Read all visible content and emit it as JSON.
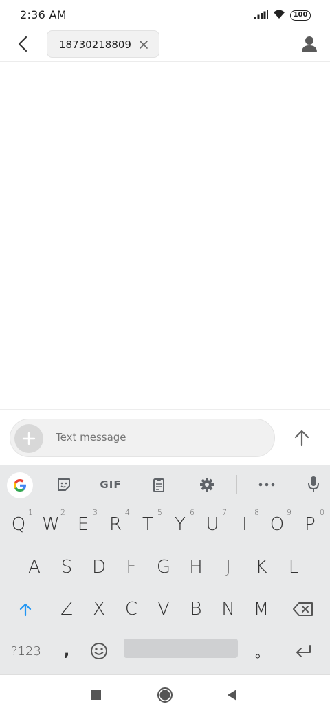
{
  "status_bar": {
    "time": "2:36 AM",
    "battery": "100",
    "icons": [
      "signal-icon",
      "wifi-icon",
      "battery-icon"
    ]
  },
  "header": {
    "recipient": "18730218809",
    "icons": [
      "back-arrow-icon",
      "close-icon",
      "contact-person-icon"
    ]
  },
  "compose": {
    "placeholder": "Text message",
    "icons": [
      "add-icon",
      "send-arrow-icon"
    ]
  },
  "keyboard": {
    "toolbar": {
      "gif_label": "GIF",
      "icons": [
        "google-g-icon",
        "sticker-icon",
        "clipboard-icon",
        "settings-gear-icon",
        "more-dots-icon",
        "microphone-icon"
      ]
    },
    "row1": [
      {
        "key": "Q",
        "hint": "1"
      },
      {
        "key": "W",
        "hint": "2"
      },
      {
        "key": "E",
        "hint": "3"
      },
      {
        "key": "R",
        "hint": "4"
      },
      {
        "key": "T",
        "hint": "5"
      },
      {
        "key": "Y",
        "hint": "6"
      },
      {
        "key": "U",
        "hint": "7"
      },
      {
        "key": "I",
        "hint": "8"
      },
      {
        "key": "O",
        "hint": "9"
      },
      {
        "key": "P",
        "hint": "0"
      }
    ],
    "row2": [
      "A",
      "S",
      "D",
      "F",
      "G",
      "H",
      "J",
      "K",
      "L"
    ],
    "row3": [
      "Z",
      "X",
      "C",
      "V",
      "B",
      "N",
      "M"
    ],
    "row4": {
      "symbols": "?123",
      "comma": ",",
      "period": "。"
    },
    "accent_color": "#2196f3"
  },
  "nav_bar": {
    "icons": [
      "recent-apps-square-icon",
      "home-circle-icon",
      "back-triangle-icon"
    ]
  }
}
